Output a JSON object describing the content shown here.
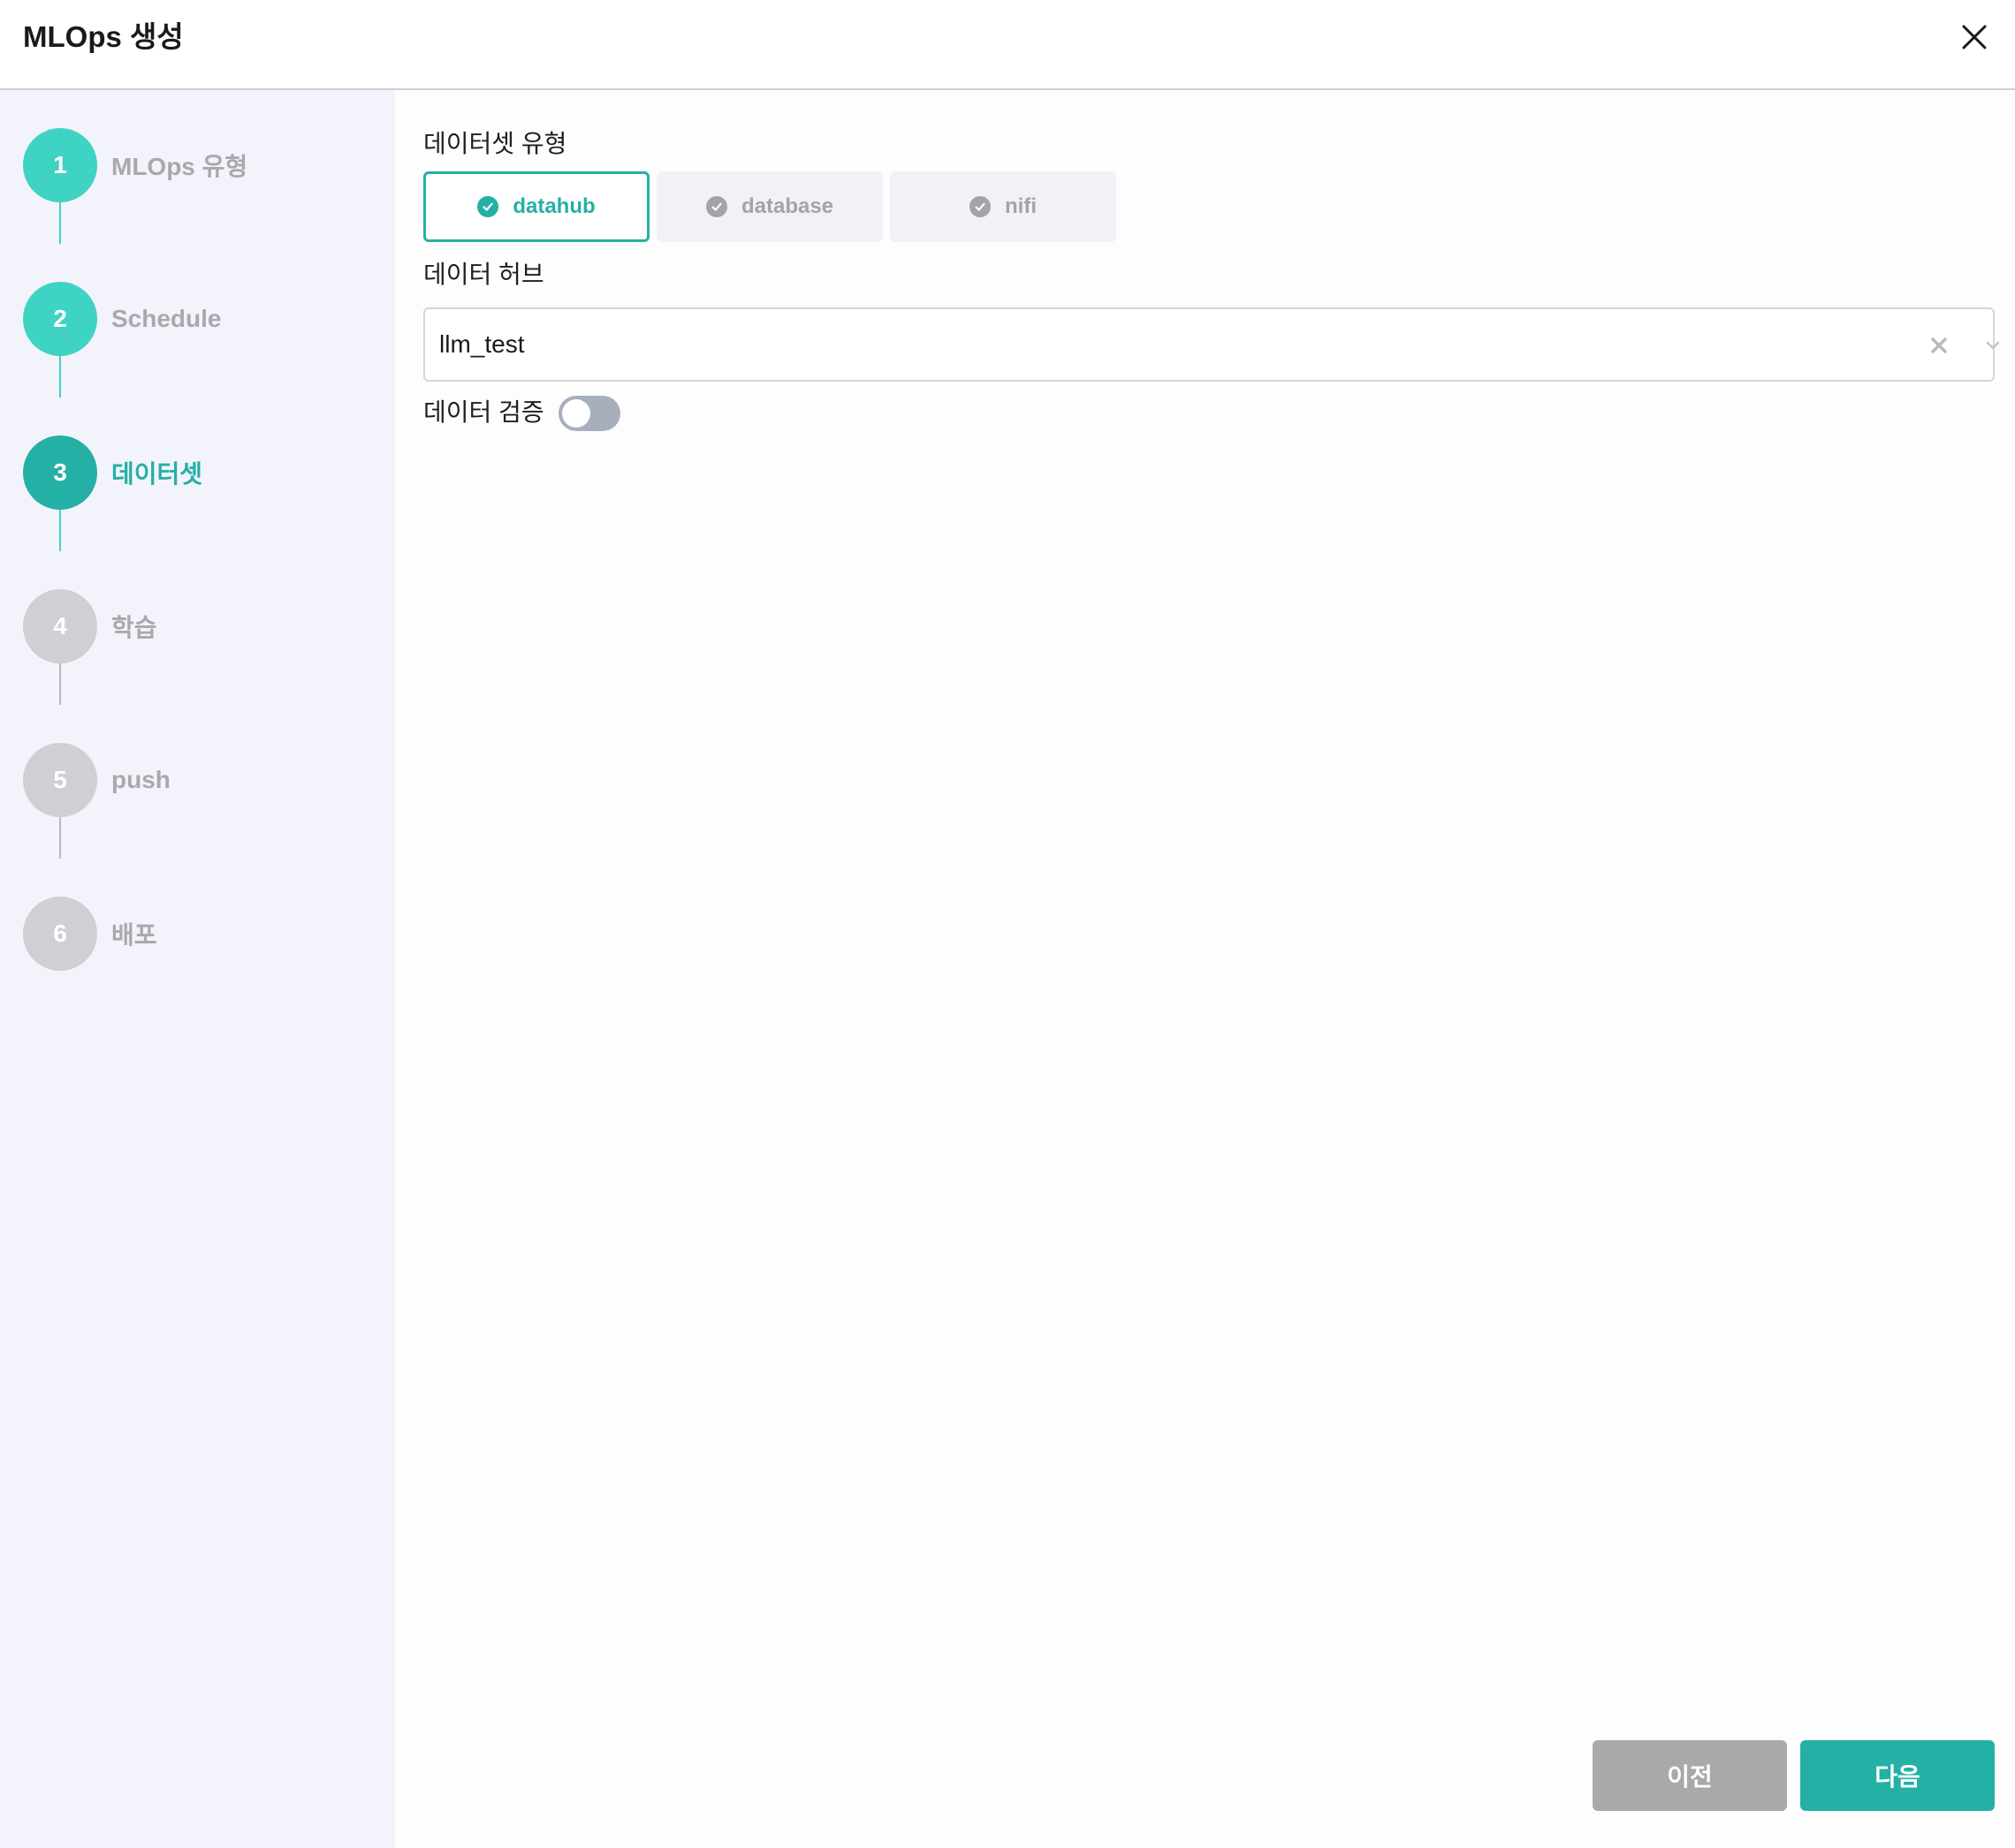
{
  "header": {
    "title": "MLOps 생성"
  },
  "steps": [
    {
      "number": "1",
      "label": "MLOps 유형",
      "state": "done"
    },
    {
      "number": "2",
      "label": "Schedule",
      "state": "done"
    },
    {
      "number": "3",
      "label": "데이터셋",
      "state": "active"
    },
    {
      "number": "4",
      "label": "학습",
      "state": "pending"
    },
    {
      "number": "5",
      "label": "push",
      "state": "pending"
    },
    {
      "number": "6",
      "label": "배포",
      "state": "pending"
    }
  ],
  "dataset_type": {
    "label": "데이터셋 유형",
    "options": [
      {
        "label": "datahub",
        "selected": true
      },
      {
        "label": "database",
        "selected": false
      },
      {
        "label": "nifi",
        "selected": false
      }
    ]
  },
  "datahub": {
    "label": "데이터 허브",
    "value": "llm_test"
  },
  "validation": {
    "label": "데이터 검증",
    "enabled": false
  },
  "footer": {
    "prev_label": "이전",
    "next_label": "다음"
  },
  "colors": {
    "accent": "#25b0a5",
    "done": "#3fd3c4",
    "pending": "#cfcfd4"
  },
  "icons": {
    "close": "close-icon",
    "check": "check-circle-icon",
    "clear": "clear-icon",
    "dropdown": "chevron-down-icon"
  }
}
